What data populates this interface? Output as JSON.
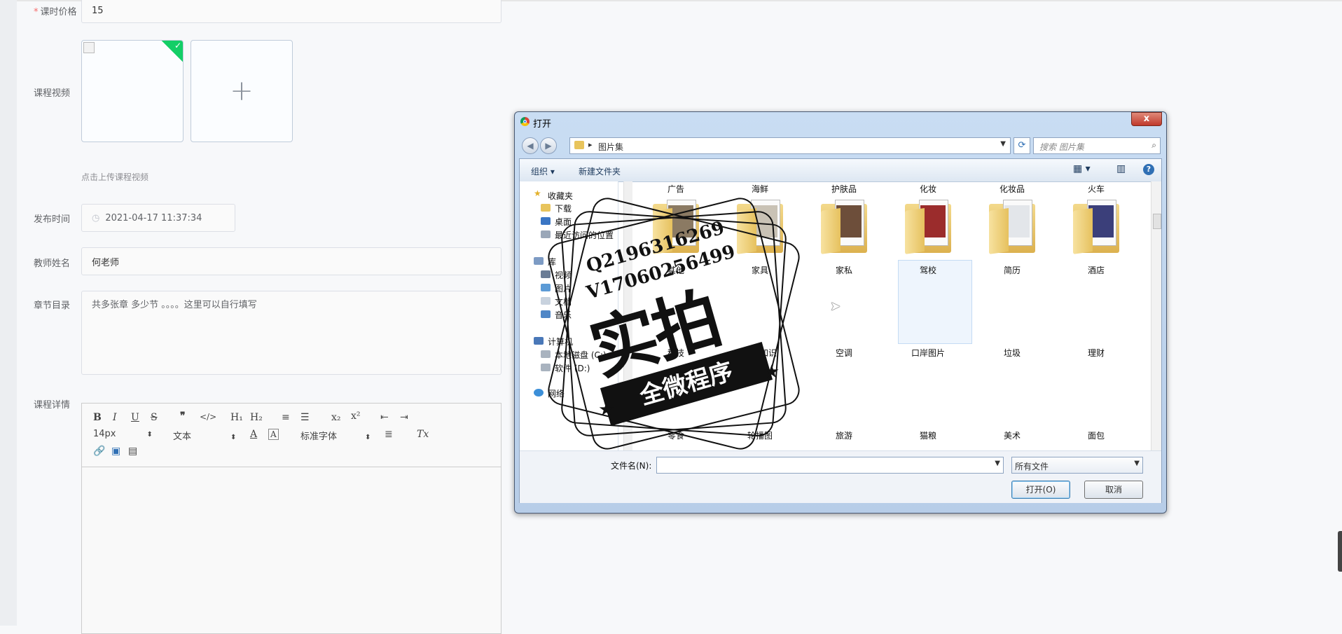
{
  "form": {
    "price_label": "课时价格",
    "price_value": "15",
    "video_label": "课程视频",
    "upload_hint": "点击上传课程视频",
    "publish_label": "发布时间",
    "publish_value": "2021-04-17 11:37:34",
    "teacher_label": "教师姓名",
    "teacher_value": "何老师",
    "chapter_label": "章节目录",
    "chapter_value": "共多张章 多少节 。。。。这里可以自行填写",
    "detail_label": "课程详情"
  },
  "editor": {
    "font_size": "14px",
    "header_select": "文本",
    "font_select": "标准字体"
  },
  "dialog": {
    "title": "打开",
    "close_label": "x",
    "path": "图片集",
    "search_placeholder": "搜索 图片集",
    "organize": "组织 ▾",
    "new_folder": "新建文件夹",
    "help": "?",
    "nav": {
      "favorites": "收藏夹",
      "downloads": "下载",
      "desktop": "桌面",
      "recent": "最近访问的位置",
      "library": "库",
      "video": "视频",
      "pictures": "图片",
      "docs": "文档",
      "music": "音乐",
      "computer": "计算机",
      "disk_c": "本地磁盘 (C:)",
      "disk_d": "软件 (D:)",
      "network": "网络"
    },
    "row1": [
      "广告",
      "海鲜",
      "护肤品",
      "化妆",
      "化妆品",
      "火车"
    ],
    "row2": [
      "其他",
      "家具",
      "家私",
      "驾校",
      "简历",
      "酒店"
    ],
    "row3": [
      "科技",
      "科普知识",
      "空调",
      "口岸图片",
      "垃圾",
      "理财"
    ],
    "row4": [
      "零食",
      "轮播图",
      "旅游",
      "猫粮",
      "美术",
      "面包"
    ],
    "filename_label": "文件名(N):",
    "filetype": "所有文件",
    "open_btn": "打开(O)",
    "cancel_btn": "取消"
  },
  "watermark": {
    "line1": "Q2196316269",
    "line2": "V17060256499",
    "big": "实拍",
    "banner": "全微程序"
  }
}
